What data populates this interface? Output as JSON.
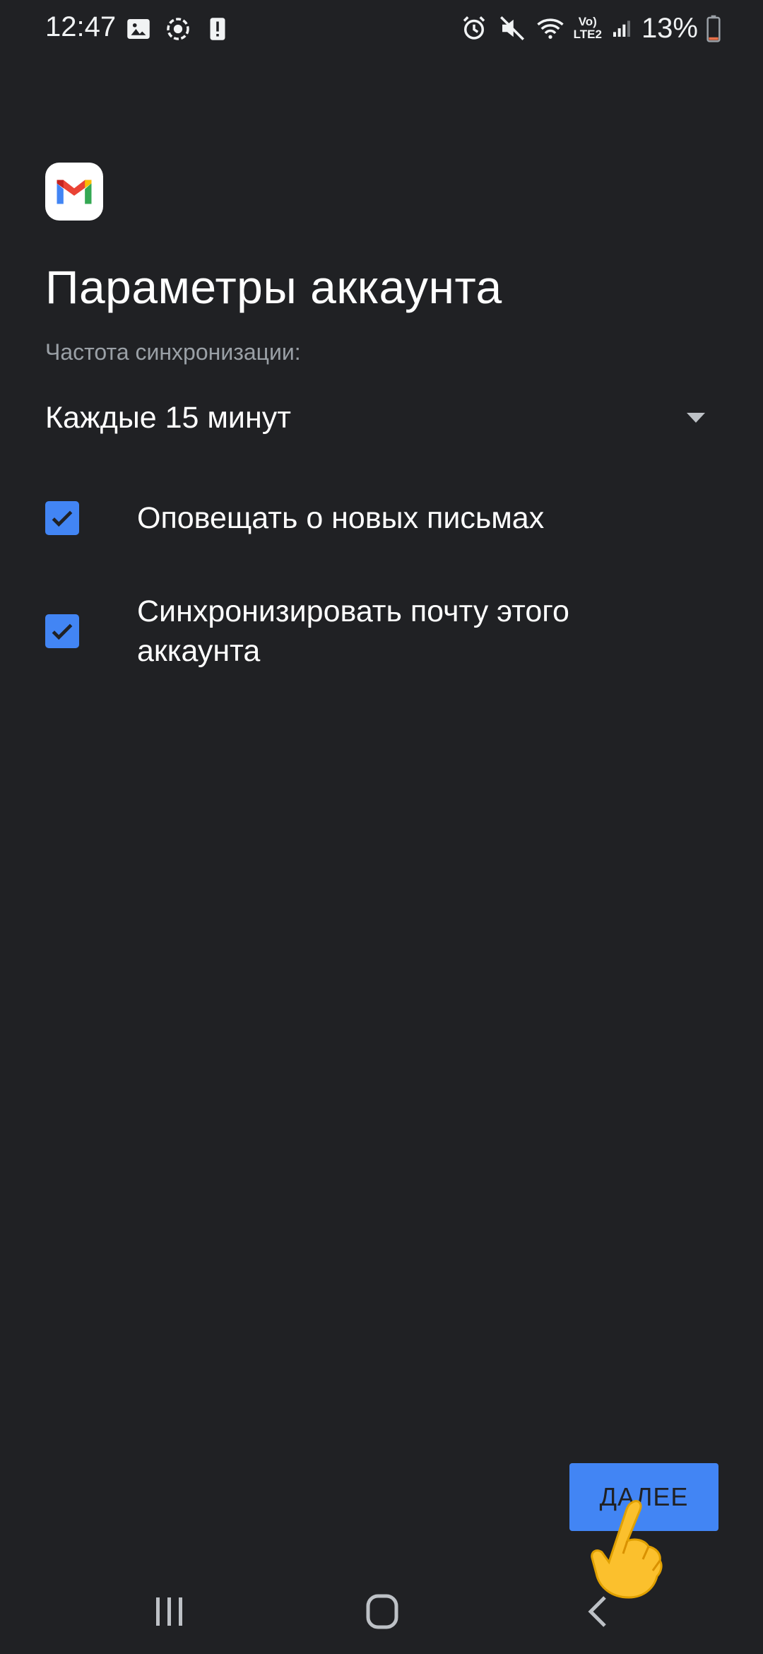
{
  "status_bar": {
    "time": "12:47",
    "battery_percent": "13%",
    "network_label_top": "Vo)",
    "network_label_bottom": "LTE2",
    "left_icons": [
      "gallery-icon",
      "screen-record-icon",
      "alert-icon"
    ],
    "right_icons": [
      "alarm-icon",
      "mute-icon",
      "wifi-icon",
      "signal-icon",
      "battery-icon"
    ],
    "battery_level": 0.13,
    "battery_color": "#e8714a"
  },
  "app": {
    "icon": "gmail-icon",
    "title": "Параметры аккаунта"
  },
  "sync": {
    "label": "Частота синхронизации:",
    "selected": "Каждые 15 минут"
  },
  "options": [
    {
      "label": "Оповещать о новых письмах",
      "checked": true
    },
    {
      "label": "Синхронизировать почту этого аккаунта",
      "checked": true
    }
  ],
  "actions": {
    "next_label": "ДАЛЕЕ"
  },
  "navigation": {
    "buttons": [
      "recents-icon",
      "home-icon",
      "back-icon"
    ]
  },
  "colors": {
    "background": "#202124",
    "accent": "#4285f4",
    "secondary_text": "#9aa0a6"
  }
}
